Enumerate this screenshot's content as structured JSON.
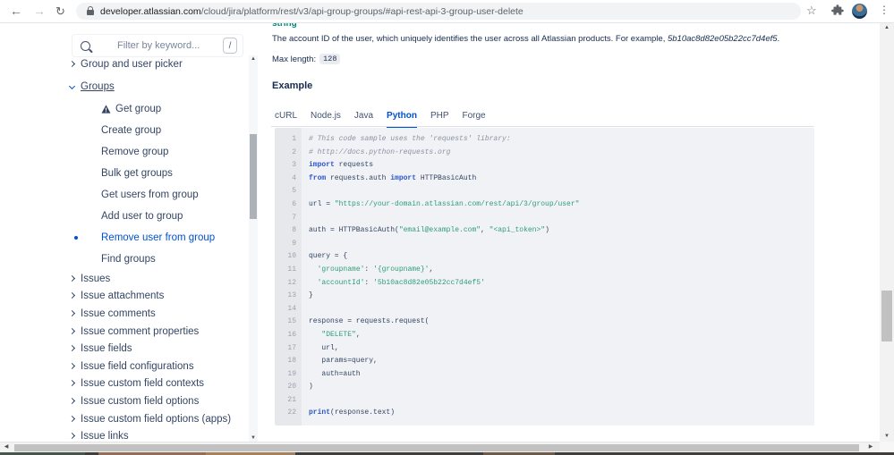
{
  "browser": {
    "url_domain": "developer.atlassian.com",
    "url_path": "/cloud/jira/platform/rest/v3/api-group-groups/#api-rest-api-3-group-user-delete"
  },
  "sidebar": {
    "filter_placeholder": "Filter by keyword...",
    "shortcut_badge": "/",
    "items": [
      {
        "label": "Group and user picker",
        "chevron": "right",
        "section": "top"
      },
      {
        "label": "Groups",
        "chevron": "down",
        "underline": true,
        "expanded": true,
        "section": "top"
      },
      {
        "label": "Get group",
        "indent": true,
        "warning": true,
        "section": "groups"
      },
      {
        "label": "Create group",
        "indent": true,
        "section": "groups"
      },
      {
        "label": "Remove group",
        "indent": true,
        "section": "groups"
      },
      {
        "label": "Bulk get groups",
        "indent": true,
        "section": "groups"
      },
      {
        "label": "Get users from group",
        "indent": true,
        "section": "groups"
      },
      {
        "label": "Add user to group",
        "indent": true,
        "section": "groups"
      },
      {
        "label": "Remove user from group",
        "indent": true,
        "active": true,
        "section": "groups"
      },
      {
        "label": "Find groups",
        "indent": true,
        "section": "groups"
      },
      {
        "label": "Issues",
        "chevron": "right",
        "section": "issues"
      },
      {
        "label": "Issue attachments",
        "chevron": "right",
        "section": "issues"
      },
      {
        "label": "Issue comments",
        "chevron": "right",
        "section": "issues"
      },
      {
        "label": "Issue comment properties",
        "chevron": "right",
        "section": "issues"
      },
      {
        "label": "Issue fields",
        "chevron": "right",
        "section": "issues"
      },
      {
        "label": "Issue field configurations",
        "chevron": "right",
        "section": "issues"
      },
      {
        "label": "Issue custom field contexts",
        "chevron": "right",
        "section": "issues"
      },
      {
        "label": "Issue custom field options",
        "chevron": "right",
        "section": "issues"
      },
      {
        "label": "Issue custom field options (apps)",
        "chevron": "right",
        "section": "issues"
      },
      {
        "label": "Issue links",
        "chevron": "right",
        "section": "issues"
      }
    ]
  },
  "main": {
    "type_label": "string",
    "desc_main": "The account ID of the user, which uniquely identifies the user across all Atlassian products. For example, ",
    "desc_example": "5b10ac8d82e05b22cc7d4ef5",
    "desc_tail": ".",
    "max_length_label": "Max length:",
    "max_length_value": "128",
    "example_heading": "Example",
    "tabs": [
      {
        "label": "cURL"
      },
      {
        "label": "Node.js"
      },
      {
        "label": "Java"
      },
      {
        "label": "Python",
        "active": true
      },
      {
        "label": "PHP"
      },
      {
        "label": "Forge"
      }
    ]
  },
  "code": {
    "language": "Python",
    "lines": [
      [
        {
          "c": "com",
          "t": "# This code sample uses the 'requests' library:"
        }
      ],
      [
        {
          "c": "com",
          "t": "# http://docs.python-requests.org"
        }
      ],
      [
        {
          "c": "kw",
          "t": "import"
        },
        {
          "c": "d",
          "t": " requests"
        }
      ],
      [
        {
          "c": "kw",
          "t": "from"
        },
        {
          "c": "d",
          "t": " requests.auth "
        },
        {
          "c": "kw",
          "t": "import"
        },
        {
          "c": "d",
          "t": " HTTPBasicAuth"
        }
      ],
      [],
      [
        {
          "c": "d",
          "t": "url = "
        },
        {
          "c": "str",
          "t": "\"https://your-domain.atlassian.com/rest/api/3/group/user\""
        }
      ],
      [],
      [
        {
          "c": "d",
          "t": "auth = HTTPBasicAuth("
        },
        {
          "c": "str",
          "t": "\"email@example.com\""
        },
        {
          "c": "d",
          "t": ", "
        },
        {
          "c": "str",
          "t": "\"<api_token>\""
        },
        {
          "c": "d",
          "t": ")"
        }
      ],
      [],
      [
        {
          "c": "d",
          "t": "query = {"
        }
      ],
      [
        {
          "c": "d",
          "t": "  "
        },
        {
          "c": "str",
          "t": "'groupname'"
        },
        {
          "c": "d",
          "t": ": "
        },
        {
          "c": "str",
          "t": "'{groupname}'"
        },
        {
          "c": "d",
          "t": ","
        }
      ],
      [
        {
          "c": "d",
          "t": "  "
        },
        {
          "c": "str",
          "t": "'accountId'"
        },
        {
          "c": "d",
          "t": ": "
        },
        {
          "c": "str",
          "t": "'5b10ac8d82e05b22cc7d4ef5'"
        }
      ],
      [
        {
          "c": "d",
          "t": "}"
        }
      ],
      [],
      [
        {
          "c": "d",
          "t": "response = requests.request("
        }
      ],
      [
        {
          "c": "d",
          "t": "   "
        },
        {
          "c": "str",
          "t": "\"DELETE\""
        },
        {
          "c": "d",
          "t": ","
        }
      ],
      [
        {
          "c": "d",
          "t": "   url,"
        }
      ],
      [
        {
          "c": "d",
          "t": "   params=query,"
        }
      ],
      [
        {
          "c": "d",
          "t": "   auth=auth"
        }
      ],
      [
        {
          "c": "d",
          "t": ")"
        }
      ],
      [],
      [
        {
          "c": "kw",
          "t": "print"
        },
        {
          "c": "d",
          "t": "(response.text)"
        }
      ]
    ]
  },
  "colors": {
    "accent_blue": "#0052CC",
    "sidebar_text": "#344563",
    "body_text": "#172B4D",
    "type_teal": "#00897B",
    "code_keyword": "#2c56c9",
    "code_string": "#2e9e77",
    "code_comment": "#8993a4",
    "code_bg": "#f1f2f5",
    "gutter_bg": "#e6e8ec"
  }
}
